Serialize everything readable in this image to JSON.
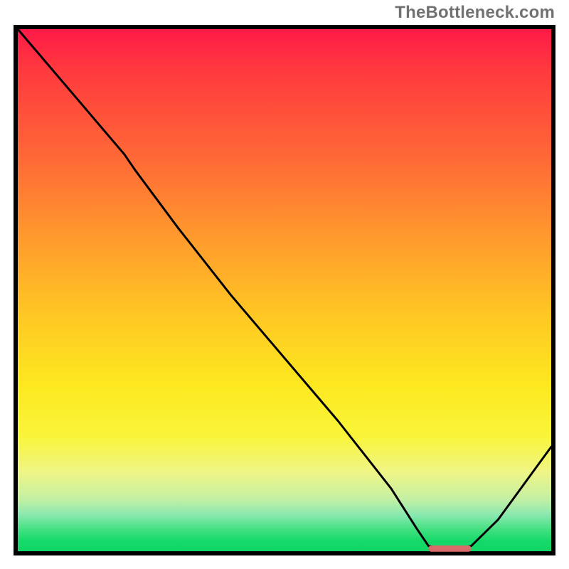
{
  "attribution": "TheBottleneck.com",
  "colors": {
    "curve": "#000000",
    "marker": "#d96b6a",
    "border": "#000000"
  },
  "chart_data": {
    "type": "line",
    "title": "",
    "xlabel": "",
    "ylabel": "",
    "xlim": [
      0,
      100
    ],
    "ylim": [
      0,
      100
    ],
    "x": [
      0,
      10,
      20,
      22,
      30,
      40,
      50,
      60,
      70,
      75,
      77,
      80,
      82,
      85,
      90,
      95,
      100
    ],
    "values": [
      100,
      88,
      76,
      73,
      62,
      49,
      37,
      25,
      12,
      4,
      1,
      0.5,
      0.5,
      1,
      6,
      13,
      20
    ],
    "marker": {
      "x_start": 77,
      "x_end": 85,
      "y": 0.5
    },
    "notes": "Curve starts top-left at 100, descends with a slight knee near x≈22, reaches a flat minimum around x≈78–84 at the very bottom (green band), then rises again toward ~20 at the right edge. No numeric axis ticks are shown in the image; values are read off relative to the plot frame."
  }
}
